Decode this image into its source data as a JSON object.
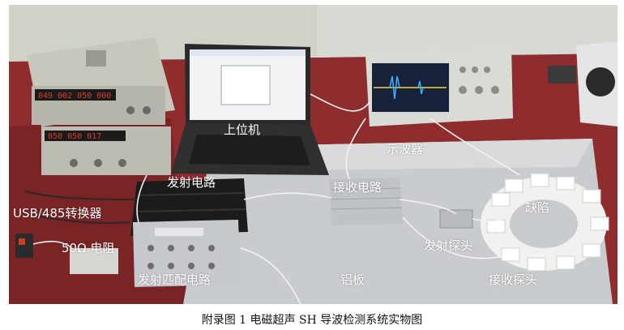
{
  "labels": {
    "host_computer": "上位机",
    "oscilloscope": "示波器",
    "transmit_circuit": "发射电路",
    "receive_circuit": "接收电路",
    "usb_converter": "USB/485转换器",
    "resistor": "50Ω 电阻",
    "transmit_probe": "发射探头",
    "defect": "缺陷",
    "matching_circuit": "发射匹配电路",
    "aluminum_plate": "铝板",
    "receive_probe": "接收探头"
  },
  "instrument_readouts": {
    "psu_upper_display": "049 002 050 000",
    "psu_lower_display": "050 050 017"
  },
  "caption": "附录图 1  电磁超声 SH 导波检测系统实物图",
  "colors": {
    "label_text": "#ffffff",
    "caption_text": "#111111",
    "plate": "#c9ccce",
    "bench": "#8e2c2e",
    "wall": "#cfd2c8"
  }
}
